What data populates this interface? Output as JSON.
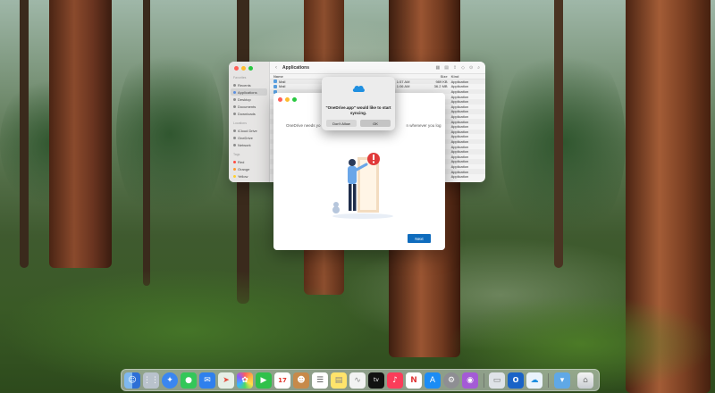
{
  "finder": {
    "title": "Applications",
    "nav_back": "‹",
    "sidebar": {
      "sections": [
        {
          "label": "Favorites",
          "items": [
            "Recents",
            "Applications",
            "Desktop",
            "Documents",
            "Downloads"
          ]
        },
        {
          "label": "Locations",
          "items": [
            "iCloud Drive",
            "OneDrive",
            "Network"
          ]
        },
        {
          "label": "Tags",
          "items": [
            "Red",
            "Orange",
            "Yellow"
          ]
        }
      ]
    },
    "columns": {
      "name": "Name",
      "date": "",
      "size": "Size",
      "kind": "Kind"
    },
    "rows": [
      {
        "name": "Mail",
        "date": "1:57 AM",
        "size": "989 KB",
        "kind": "Application"
      },
      {
        "name": "Mail",
        "date": "1:06 AM",
        "size": "36.2 MB",
        "kind": "Application"
      },
      {
        "name": "",
        "date": "",
        "size": "",
        "kind": "Application"
      },
      {
        "name": "",
        "date": "",
        "size": "",
        "kind": "Application"
      },
      {
        "name": "",
        "date": "",
        "size": "",
        "kind": "Application"
      },
      {
        "name": "",
        "date": "",
        "size": "",
        "kind": "Application"
      },
      {
        "name": "",
        "date": "",
        "size": "",
        "kind": "Application"
      },
      {
        "name": "",
        "date": "",
        "size": "",
        "kind": "Application"
      },
      {
        "name": "",
        "date": "",
        "size": "",
        "kind": "Application"
      },
      {
        "name": "",
        "date": "",
        "size": "",
        "kind": "Application"
      },
      {
        "name": "",
        "date": "",
        "size": "",
        "kind": "Application"
      },
      {
        "name": "",
        "date": "",
        "size": "",
        "kind": "Application"
      },
      {
        "name": "",
        "date": "",
        "size": "",
        "kind": "Application"
      },
      {
        "name": "",
        "date": "",
        "size": "",
        "kind": "Application"
      },
      {
        "name": "",
        "date": "",
        "size": "",
        "kind": "Application"
      },
      {
        "name": "",
        "date": "",
        "size": "",
        "kind": "Application"
      },
      {
        "name": "",
        "date": "",
        "size": "",
        "kind": "Application"
      },
      {
        "name": "",
        "date": "",
        "size": "",
        "kind": "Application"
      },
      {
        "name": "",
        "date": "",
        "size": "",
        "kind": "Application"
      },
      {
        "name": "",
        "date": "",
        "size": "",
        "kind": "Application"
      }
    ]
  },
  "onedrive": {
    "intro_left": "OneDrive needs yo",
    "intro_right": "n whenever you log",
    "next_label": "Next"
  },
  "alert": {
    "message": "\"OneDrive.app\" would like to start syncing.",
    "dont_allow_label": "Don't Allow",
    "ok_label": "OK"
  },
  "dock": {
    "calendar_day": "17",
    "appletv_label": "tv"
  },
  "colors": {
    "accent_blue": "#0f6cbd",
    "traffic_red": "#ff5f57",
    "traffic_yellow": "#febc2e",
    "traffic_green": "#28c840",
    "alert_badge": "#e03a3a"
  }
}
